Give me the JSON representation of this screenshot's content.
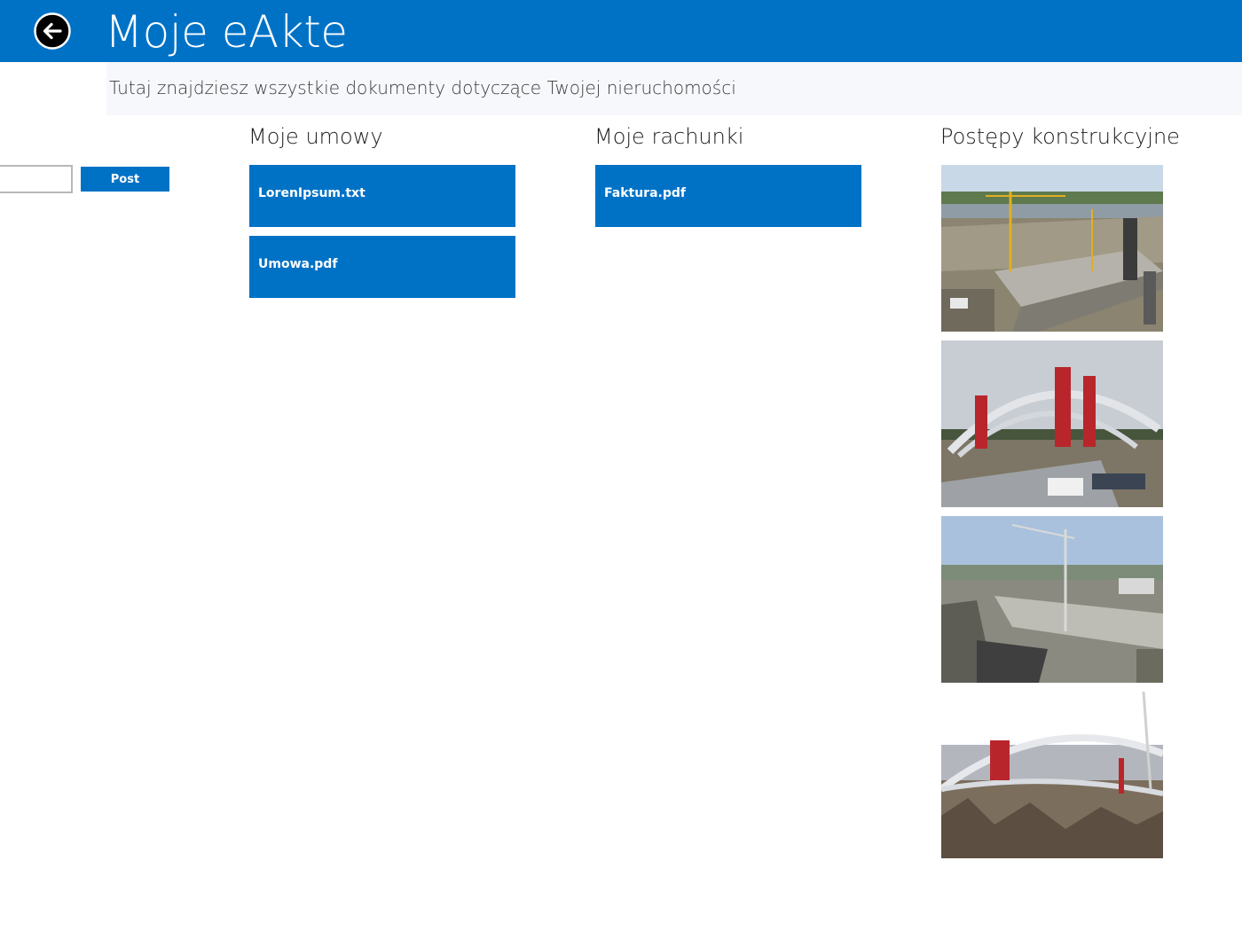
{
  "header": {
    "back_icon": "arrow-left-circle-icon",
    "title": "Moje eAkte"
  },
  "subtitle": "Tutaj znajdziesz wszystkie dokumenty dotyczące Twojej nieruchomości",
  "post_form": {
    "input_value": "",
    "button_label": "Post"
  },
  "sections": {
    "contracts": {
      "title": "Moje umowy",
      "items": [
        "LorenIpsum.txt",
        "Umowa.pdf"
      ]
    },
    "invoices": {
      "title": "Moje rachunki",
      "items": [
        "Faktura.pdf"
      ]
    },
    "progress": {
      "title": "Postępy konstrukcyjne"
    }
  },
  "colors": {
    "accent": "#0072c6",
    "subtitle_background": "#f7f8fc",
    "text": "#1e1e1e"
  }
}
